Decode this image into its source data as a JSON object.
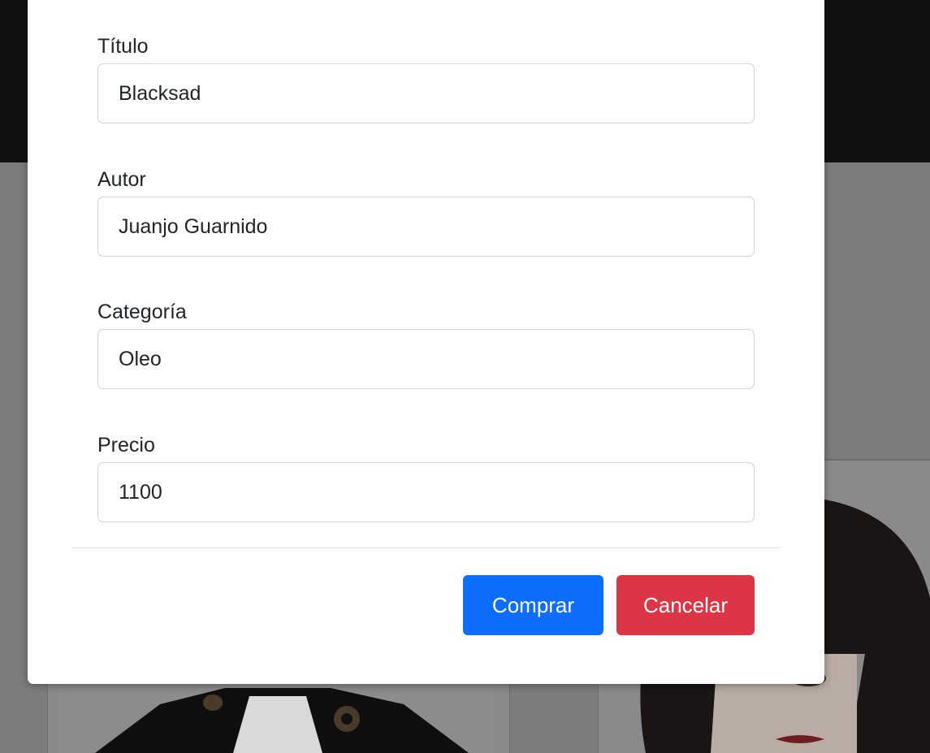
{
  "colors": {
    "primary": "#0d6efd",
    "danger": "#dc3545",
    "overlay": "#7d7d7d",
    "navbar": "#111111"
  },
  "form": {
    "fields": [
      {
        "label": "Título",
        "value": "Blacksad"
      },
      {
        "label": "Autor",
        "value": "Juanjo Guarnido"
      },
      {
        "label": "Categoría",
        "value": "Oleo"
      },
      {
        "label": "Precio",
        "value": "1100"
      }
    ]
  },
  "footer": {
    "buy_label": "Comprar",
    "cancel_label": "Cancelar"
  },
  "background": {
    "images": [
      {
        "icon": "dog-painting-image"
      },
      {
        "icon": "woman-portrait-image"
      }
    ]
  }
}
